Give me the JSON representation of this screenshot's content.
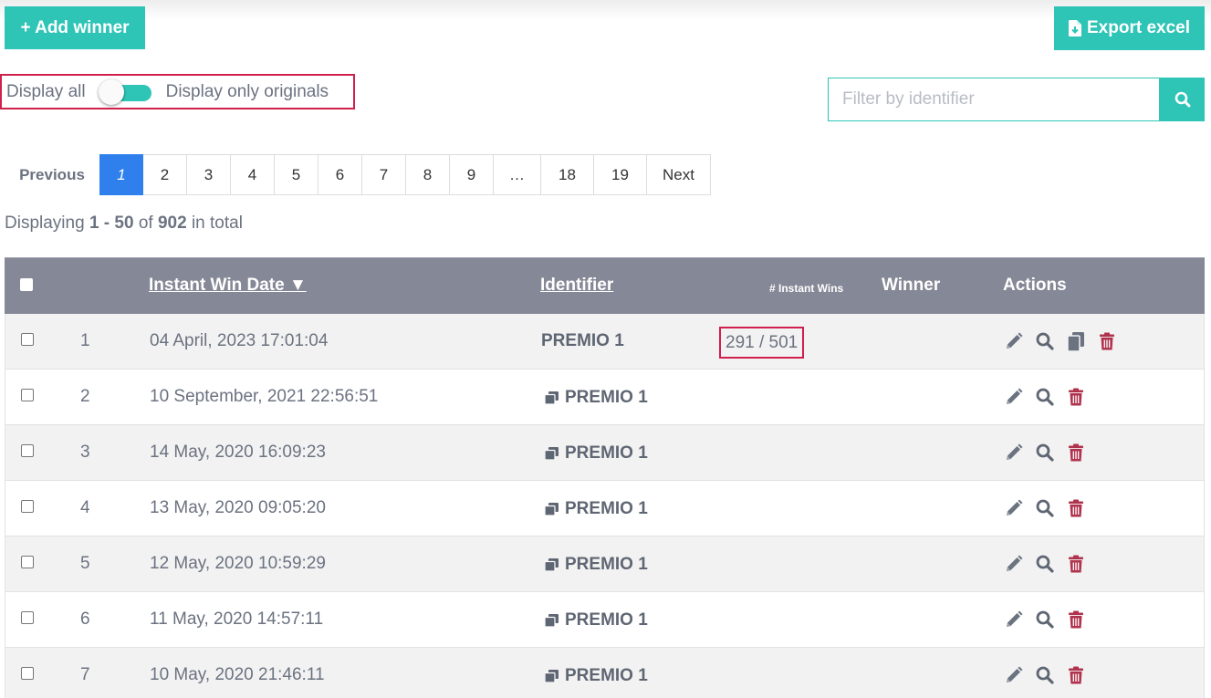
{
  "toolbar": {
    "add_label": "+ Add winner",
    "export_label": "Export excel"
  },
  "display_toggle": {
    "left_label": "Display all",
    "right_label": "Display only originals"
  },
  "filter": {
    "placeholder": "Filter by identifier"
  },
  "pagination": {
    "previous": "Previous",
    "pages": [
      "1",
      "2",
      "3",
      "4",
      "5",
      "6",
      "7",
      "8",
      "9",
      "…",
      "18",
      "19"
    ],
    "next": "Next",
    "active": "1"
  },
  "summary": {
    "prefix": "Displaying",
    "range": "1 - 50",
    "of": "of",
    "total": "902",
    "suffix": "in total"
  },
  "table": {
    "headers": {
      "date": "Instant Win Date ▼",
      "identifier": "Identifier",
      "instant_wins": "# Instant Wins",
      "winner": "Winner",
      "actions": "Actions"
    },
    "rows": [
      {
        "num": "1",
        "date": "04 April, 2023 17:01:04",
        "identifier": "PREMIO 1",
        "copy": false,
        "wins": "291 / 501",
        "clone_action": true
      },
      {
        "num": "2",
        "date": "10 September, 2021 22:56:51",
        "identifier": "PREMIO 1",
        "copy": true,
        "wins": "",
        "clone_action": false
      },
      {
        "num": "3",
        "date": "14 May, 2020 16:09:23",
        "identifier": "PREMIO 1",
        "copy": true,
        "wins": "",
        "clone_action": false
      },
      {
        "num": "4",
        "date": "13 May, 2020 09:05:20",
        "identifier": "PREMIO 1",
        "copy": true,
        "wins": "",
        "clone_action": false
      },
      {
        "num": "5",
        "date": "12 May, 2020 10:59:29",
        "identifier": "PREMIO 1",
        "copy": true,
        "wins": "",
        "clone_action": false
      },
      {
        "num": "6",
        "date": "11 May, 2020 14:57:11",
        "identifier": "PREMIO 1",
        "copy": true,
        "wins": "",
        "clone_action": false
      },
      {
        "num": "7",
        "date": "10 May, 2020 21:46:11",
        "identifier": "PREMIO 1",
        "copy": true,
        "wins": "",
        "clone_action": false
      }
    ]
  },
  "icons": {
    "edit": "pencil-icon",
    "view": "magnifier-icon",
    "clone": "copy-icon",
    "delete": "trash-icon",
    "original_marker": "copy-icon"
  },
  "colors": {
    "accent": "#2ec4b6",
    "header_bg": "#858896",
    "active_page": "#2f80ed",
    "delete": "#b0334e",
    "highlight_border": "#d0204e"
  }
}
